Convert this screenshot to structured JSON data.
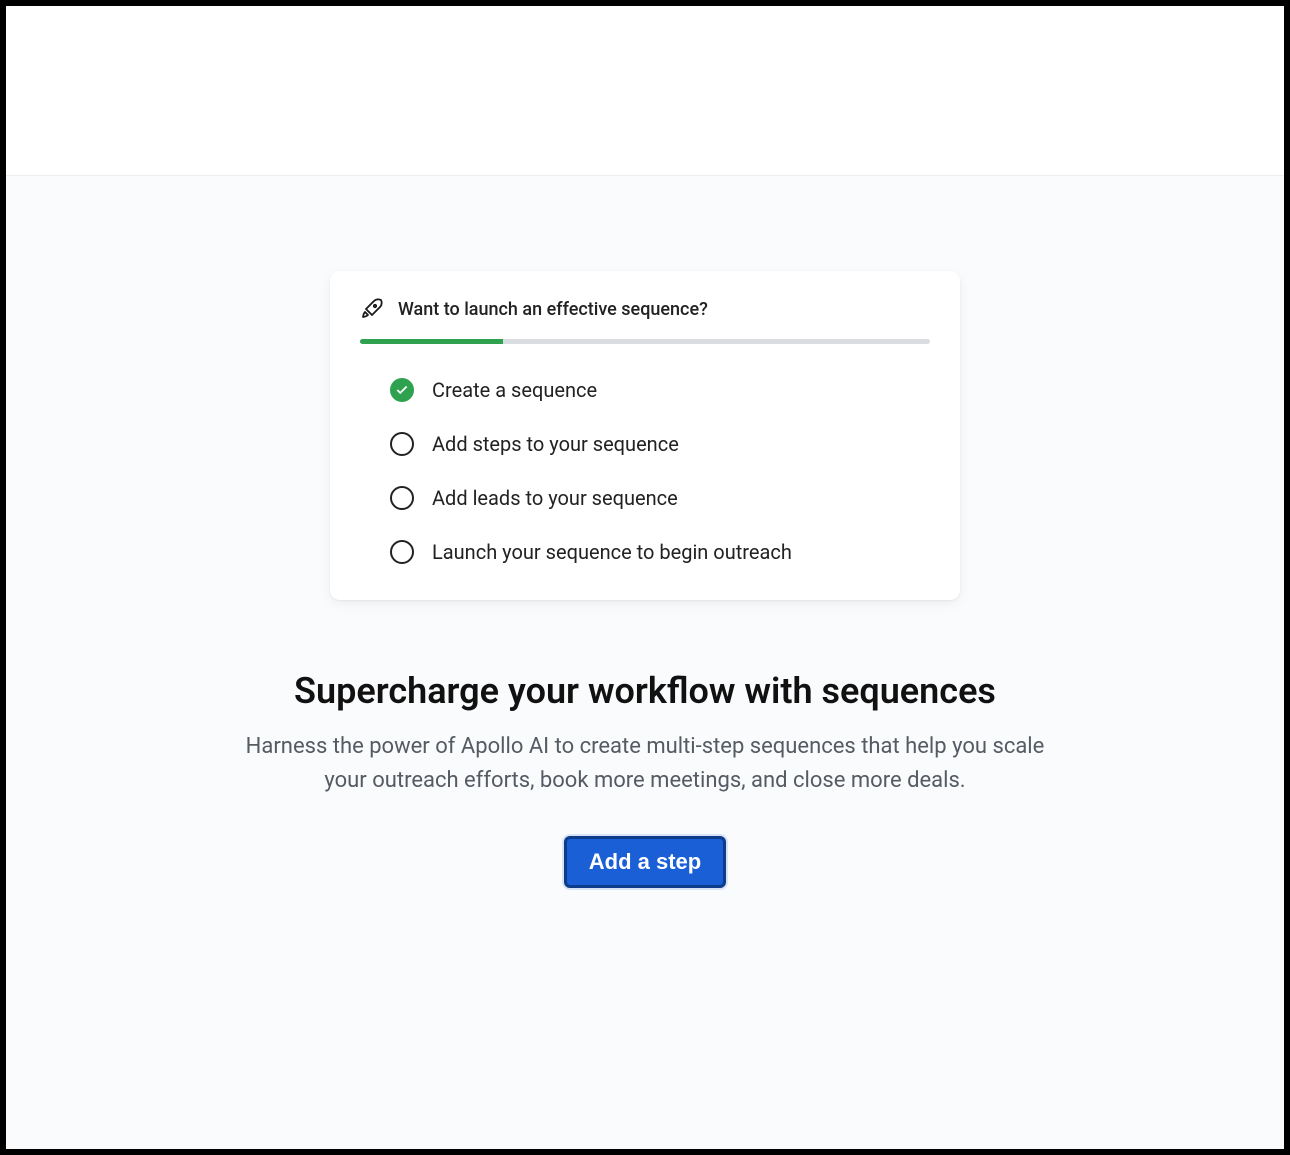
{
  "card": {
    "title": "Want to launch an effective sequence?",
    "progress_percent": 25,
    "items": [
      {
        "label": "Create a sequence",
        "done": true
      },
      {
        "label": "Add steps to your sequence",
        "done": false
      },
      {
        "label": "Add leads to your sequence",
        "done": false
      },
      {
        "label": "Launch your sequence to begin outreach",
        "done": false
      }
    ]
  },
  "hero": {
    "heading": "Supercharge your workflow with sequences",
    "subtext": "Harness the power of Apollo AI to create multi-step sequences that help you scale your outreach efforts, book more meetings, and close more deals."
  },
  "cta": {
    "label": "Add a step"
  },
  "colors": {
    "accent_green": "#2fa24f",
    "button_blue": "#1a5fd6",
    "button_border": "#0d3c8a"
  }
}
